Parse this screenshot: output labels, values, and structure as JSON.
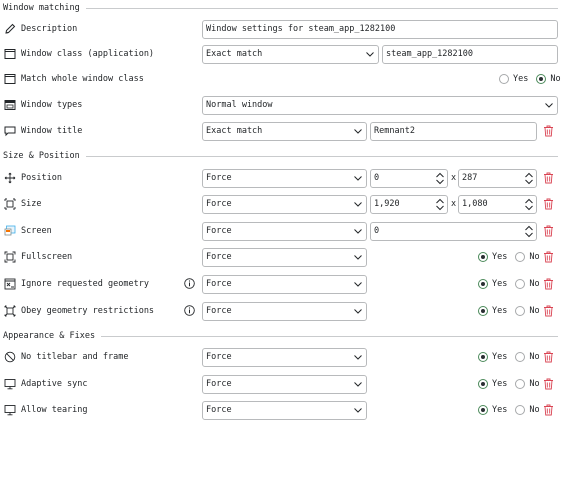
{
  "sections": {
    "window_matching": "Window matching",
    "size_position": "Size & Position",
    "appearance": "Appearance & Fixes"
  },
  "rows": {
    "description": {
      "label": "Description",
      "value": "Window settings for steam_app_1282100"
    },
    "window_class": {
      "label": "Window class (application)",
      "match": "Exact match",
      "value": "steam_app_1282100"
    },
    "whole_class": {
      "label": "Match whole window class",
      "yes": "Yes",
      "no": "No",
      "selected": "No"
    },
    "window_types": {
      "label": "Window types",
      "value": "Normal window"
    },
    "window_title": {
      "label": "Window title",
      "match": "Exact match",
      "value": "Remnant2"
    },
    "position": {
      "label": "Position",
      "mode": "Force",
      "x": "0",
      "y": "287",
      "sep": "x"
    },
    "size": {
      "label": "Size",
      "mode": "Force",
      "w": "1,920",
      "h": "1,080",
      "sep": "x"
    },
    "screen": {
      "label": "Screen",
      "mode": "Force",
      "value": "0"
    },
    "fullscreen": {
      "label": "Fullscreen",
      "mode": "Force",
      "yes": "Yes",
      "no": "No",
      "selected": "Yes"
    },
    "ignore_geometry": {
      "label": "Ignore requested geometry",
      "mode": "Force",
      "yes": "Yes",
      "no": "No",
      "selected": "Yes"
    },
    "obey_geometry": {
      "label": "Obey geometry restrictions",
      "mode": "Force",
      "yes": "Yes",
      "no": "No",
      "selected": "Yes"
    },
    "no_titlebar": {
      "label": "No titlebar and frame",
      "mode": "Force",
      "yes": "Yes",
      "no": "No",
      "selected": "Yes"
    },
    "adaptive_sync": {
      "label": "Adaptive sync",
      "mode": "Force",
      "yes": "Yes",
      "no": "No",
      "selected": "Yes"
    },
    "allow_tearing": {
      "label": "Allow tearing",
      "mode": "Force",
      "yes": "Yes",
      "no": "No",
      "selected": "Yes"
    }
  },
  "colors": {
    "delete": "#da4453",
    "border": "#b8babc",
    "radio_checked_border": "#4c8a5b"
  }
}
